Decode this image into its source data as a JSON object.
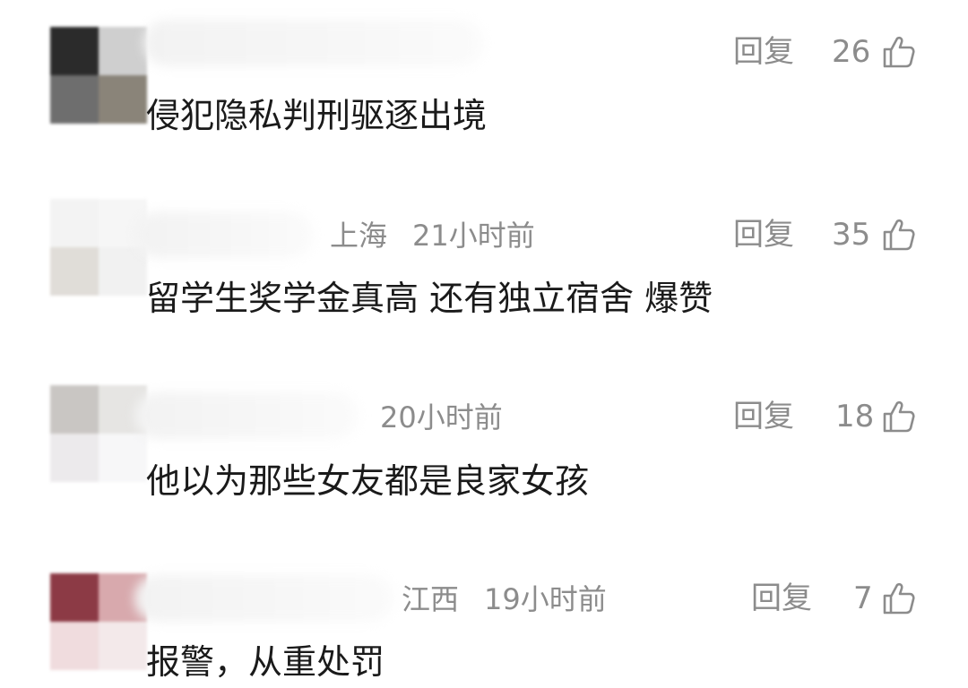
{
  "comments": [
    {
      "location": "",
      "time": "",
      "reply_label": "回复",
      "likes": "26",
      "text": "侵犯隐私判刑驱逐出境"
    },
    {
      "location": "上海",
      "time": "21小时前",
      "reply_label": "回复",
      "likes": "35",
      "text": "留学生奖学金真高 还有独立宿舍 爆赞"
    },
    {
      "location": "",
      "time": "20小时前",
      "reply_label": "回复",
      "likes": "18",
      "text": "他以为那些女友都是良家女孩"
    },
    {
      "location": "江西",
      "time": "19小时前",
      "reply_label": "回复",
      "likes": "7",
      "text": "报警，从重处罚"
    }
  ],
  "icons": {
    "like": "thumb-up-icon"
  },
  "colors": {
    "meta_gray": "#8c8c8c",
    "text_dark": "#1a1a1a"
  }
}
